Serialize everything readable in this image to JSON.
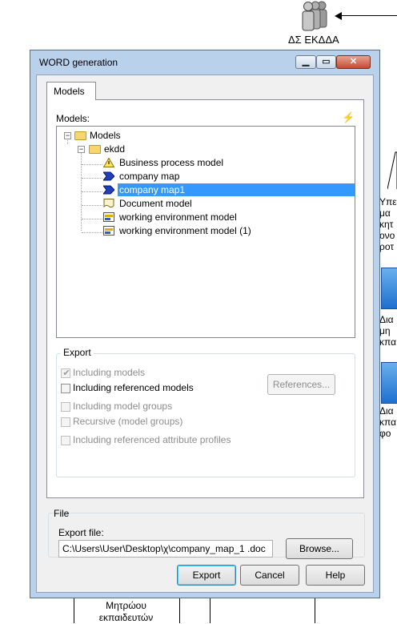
{
  "background": {
    "top_label": "ΔΣ ΕΚΔΔΑ",
    "right_texts": [
      "Υπε\nμα\nκητ\nονο\nροτ",
      "Δια\nμη\nκπα",
      "Δια\nκπα\nφο"
    ],
    "bottom_label": "Μητρώου\nεκπαιδευτών"
  },
  "dialog": {
    "title": "WORD generation",
    "tab": "Models",
    "models_label": "Models:",
    "tree": {
      "root": "Models",
      "folder": "ekdd",
      "items": [
        {
          "label": "Business process model",
          "icon": "warning-model-icon",
          "selected": false
        },
        {
          "label": "company map",
          "icon": "blue-arrow-model-icon",
          "selected": false
        },
        {
          "label": "company map1",
          "icon": "blue-arrow-model-icon",
          "selected": true
        },
        {
          "label": "Document model",
          "icon": "document-model-icon",
          "selected": false
        },
        {
          "label": "working environment model",
          "icon": "environment-model-icon",
          "selected": false
        },
        {
          "label": "working environment model (1)",
          "icon": "environment-model-icon",
          "selected": false
        }
      ]
    },
    "export": {
      "title": "Export",
      "including_models": "Including models",
      "including_models_checked": true,
      "including_referenced_models": "Including referenced models",
      "including_referenced_models_checked": false,
      "references_button": "References...",
      "including_model_groups": "Including model groups",
      "recursive": "Recursive (model groups)",
      "including_referenced_attribute_profiles": "Including referenced attribute profiles"
    },
    "file": {
      "title": "File",
      "export_file_label": "Export file:",
      "export_file_value": "C:\\Users\\User\\Desktop\\χ\\company_map_1 .doc",
      "browse_button": "Browse..."
    },
    "buttons": {
      "export": "Export",
      "cancel": "Cancel",
      "help": "Help"
    }
  }
}
